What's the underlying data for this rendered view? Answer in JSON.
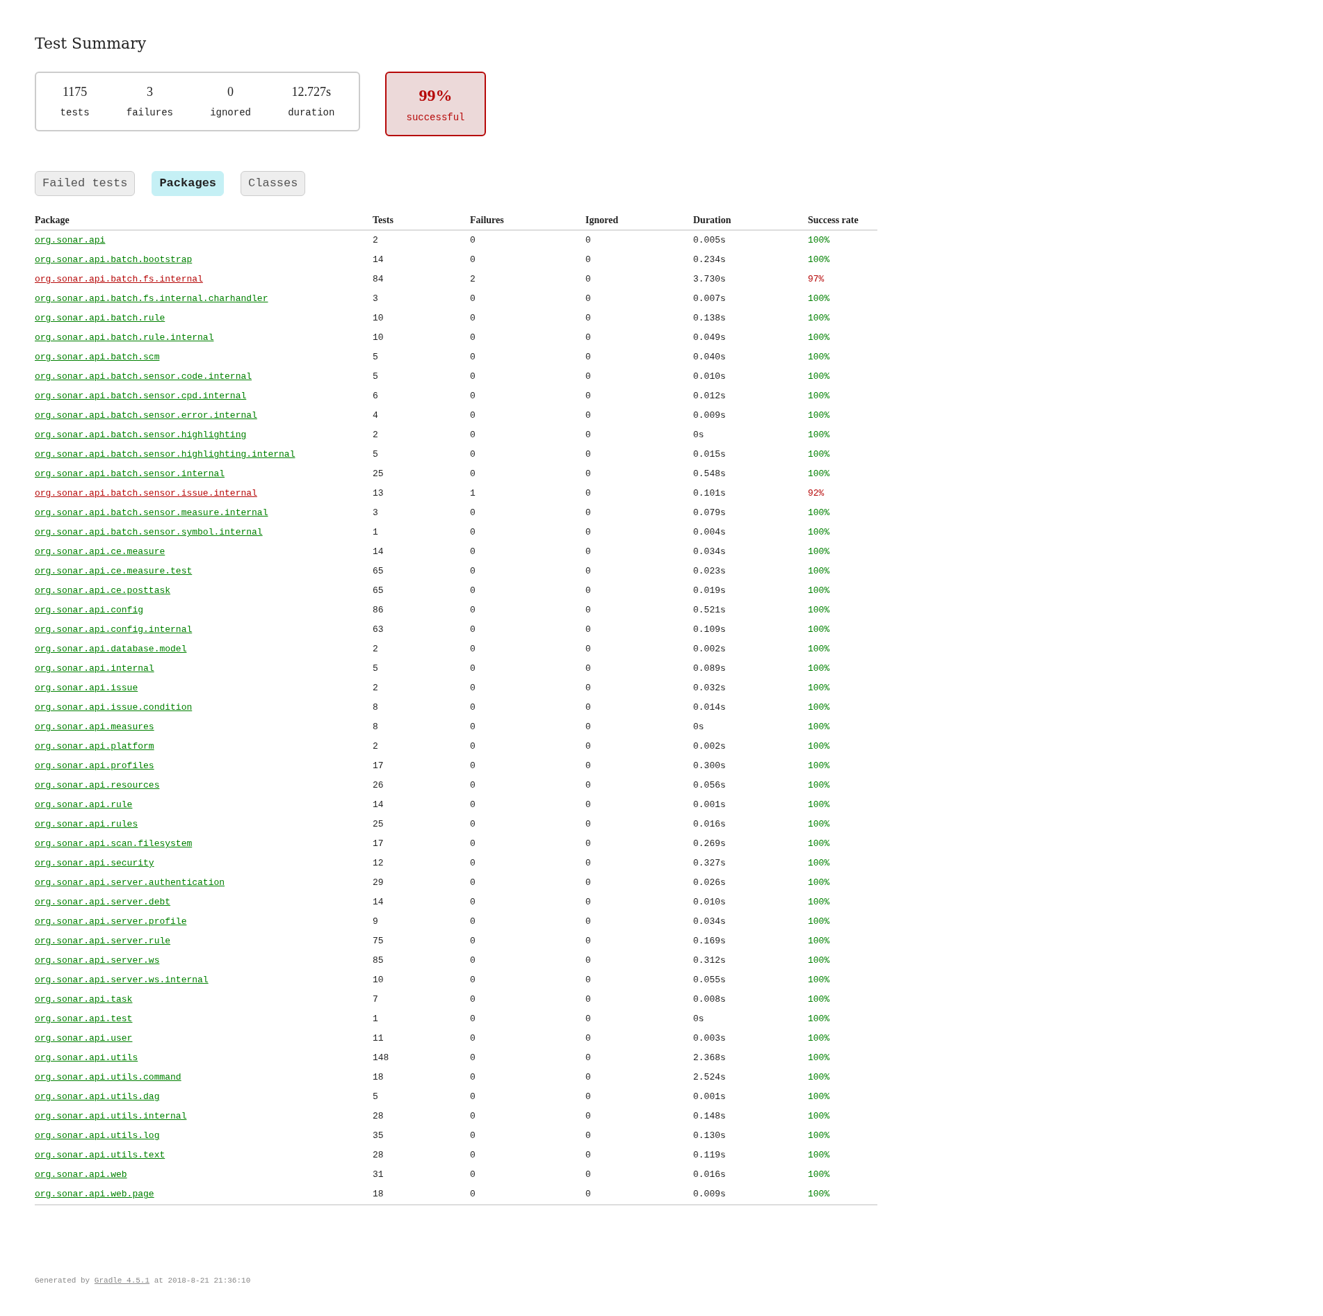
{
  "title": "Test Summary",
  "counters": [
    {
      "value": "1175",
      "label": "tests"
    },
    {
      "value": "3",
      "label": "failures"
    },
    {
      "value": "0",
      "label": "ignored"
    },
    {
      "value": "12.727s",
      "label": "duration"
    }
  ],
  "success": {
    "value": "99%",
    "label": "successful",
    "failed": true
  },
  "tabs": [
    {
      "label": "Failed tests",
      "selected": false
    },
    {
      "label": "Packages",
      "selected": true
    },
    {
      "label": "Classes",
      "selected": false
    }
  ],
  "table": {
    "columns": [
      "Package",
      "Tests",
      "Failures",
      "Ignored",
      "Duration",
      "Success rate"
    ],
    "rows": [
      {
        "package": "org.sonar.api",
        "tests": "2",
        "failures": "0",
        "ignored": "0",
        "duration": "0.005s",
        "success_rate": "100%",
        "failed": false
      },
      {
        "package": "org.sonar.api.batch.bootstrap",
        "tests": "14",
        "failures": "0",
        "ignored": "0",
        "duration": "0.234s",
        "success_rate": "100%",
        "failed": false
      },
      {
        "package": "org.sonar.api.batch.fs.internal",
        "tests": "84",
        "failures": "2",
        "ignored": "0",
        "duration": "3.730s",
        "success_rate": "97%",
        "failed": true
      },
      {
        "package": "org.sonar.api.batch.fs.internal.charhandler",
        "tests": "3",
        "failures": "0",
        "ignored": "0",
        "duration": "0.007s",
        "success_rate": "100%",
        "failed": false
      },
      {
        "package": "org.sonar.api.batch.rule",
        "tests": "10",
        "failures": "0",
        "ignored": "0",
        "duration": "0.138s",
        "success_rate": "100%",
        "failed": false
      },
      {
        "package": "org.sonar.api.batch.rule.internal",
        "tests": "10",
        "failures": "0",
        "ignored": "0",
        "duration": "0.049s",
        "success_rate": "100%",
        "failed": false
      },
      {
        "package": "org.sonar.api.batch.scm",
        "tests": "5",
        "failures": "0",
        "ignored": "0",
        "duration": "0.040s",
        "success_rate": "100%",
        "failed": false
      },
      {
        "package": "org.sonar.api.batch.sensor.code.internal",
        "tests": "5",
        "failures": "0",
        "ignored": "0",
        "duration": "0.010s",
        "success_rate": "100%",
        "failed": false
      },
      {
        "package": "org.sonar.api.batch.sensor.cpd.internal",
        "tests": "6",
        "failures": "0",
        "ignored": "0",
        "duration": "0.012s",
        "success_rate": "100%",
        "failed": false
      },
      {
        "package": "org.sonar.api.batch.sensor.error.internal",
        "tests": "4",
        "failures": "0",
        "ignored": "0",
        "duration": "0.009s",
        "success_rate": "100%",
        "failed": false
      },
      {
        "package": "org.sonar.api.batch.sensor.highlighting",
        "tests": "2",
        "failures": "0",
        "ignored": "0",
        "duration": "0s",
        "success_rate": "100%",
        "failed": false
      },
      {
        "package": "org.sonar.api.batch.sensor.highlighting.internal",
        "tests": "5",
        "failures": "0",
        "ignored": "0",
        "duration": "0.015s",
        "success_rate": "100%",
        "failed": false
      },
      {
        "package": "org.sonar.api.batch.sensor.internal",
        "tests": "25",
        "failures": "0",
        "ignored": "0",
        "duration": "0.548s",
        "success_rate": "100%",
        "failed": false
      },
      {
        "package": "org.sonar.api.batch.sensor.issue.internal",
        "tests": "13",
        "failures": "1",
        "ignored": "0",
        "duration": "0.101s",
        "success_rate": "92%",
        "failed": true
      },
      {
        "package": "org.sonar.api.batch.sensor.measure.internal",
        "tests": "3",
        "failures": "0",
        "ignored": "0",
        "duration": "0.079s",
        "success_rate": "100%",
        "failed": false
      },
      {
        "package": "org.sonar.api.batch.sensor.symbol.internal",
        "tests": "1",
        "failures": "0",
        "ignored": "0",
        "duration": "0.004s",
        "success_rate": "100%",
        "failed": false
      },
      {
        "package": "org.sonar.api.ce.measure",
        "tests": "14",
        "failures": "0",
        "ignored": "0",
        "duration": "0.034s",
        "success_rate": "100%",
        "failed": false
      },
      {
        "package": "org.sonar.api.ce.measure.test",
        "tests": "65",
        "failures": "0",
        "ignored": "0",
        "duration": "0.023s",
        "success_rate": "100%",
        "failed": false
      },
      {
        "package": "org.sonar.api.ce.posttask",
        "tests": "65",
        "failures": "0",
        "ignored": "0",
        "duration": "0.019s",
        "success_rate": "100%",
        "failed": false
      },
      {
        "package": "org.sonar.api.config",
        "tests": "86",
        "failures": "0",
        "ignored": "0",
        "duration": "0.521s",
        "success_rate": "100%",
        "failed": false
      },
      {
        "package": "org.sonar.api.config.internal",
        "tests": "63",
        "failures": "0",
        "ignored": "0",
        "duration": "0.109s",
        "success_rate": "100%",
        "failed": false
      },
      {
        "package": "org.sonar.api.database.model",
        "tests": "2",
        "failures": "0",
        "ignored": "0",
        "duration": "0.002s",
        "success_rate": "100%",
        "failed": false
      },
      {
        "package": "org.sonar.api.internal",
        "tests": "5",
        "failures": "0",
        "ignored": "0",
        "duration": "0.089s",
        "success_rate": "100%",
        "failed": false
      },
      {
        "package": "org.sonar.api.issue",
        "tests": "2",
        "failures": "0",
        "ignored": "0",
        "duration": "0.032s",
        "success_rate": "100%",
        "failed": false
      },
      {
        "package": "org.sonar.api.issue.condition",
        "tests": "8",
        "failures": "0",
        "ignored": "0",
        "duration": "0.014s",
        "success_rate": "100%",
        "failed": false
      },
      {
        "package": "org.sonar.api.measures",
        "tests": "8",
        "failures": "0",
        "ignored": "0",
        "duration": "0s",
        "success_rate": "100%",
        "failed": false
      },
      {
        "package": "org.sonar.api.platform",
        "tests": "2",
        "failures": "0",
        "ignored": "0",
        "duration": "0.002s",
        "success_rate": "100%",
        "failed": false
      },
      {
        "package": "org.sonar.api.profiles",
        "tests": "17",
        "failures": "0",
        "ignored": "0",
        "duration": "0.300s",
        "success_rate": "100%",
        "failed": false
      },
      {
        "package": "org.sonar.api.resources",
        "tests": "26",
        "failures": "0",
        "ignored": "0",
        "duration": "0.056s",
        "success_rate": "100%",
        "failed": false
      },
      {
        "package": "org.sonar.api.rule",
        "tests": "14",
        "failures": "0",
        "ignored": "0",
        "duration": "0.001s",
        "success_rate": "100%",
        "failed": false
      },
      {
        "package": "org.sonar.api.rules",
        "tests": "25",
        "failures": "0",
        "ignored": "0",
        "duration": "0.016s",
        "success_rate": "100%",
        "failed": false
      },
      {
        "package": "org.sonar.api.scan.filesystem",
        "tests": "17",
        "failures": "0",
        "ignored": "0",
        "duration": "0.269s",
        "success_rate": "100%",
        "failed": false
      },
      {
        "package": "org.sonar.api.security",
        "tests": "12",
        "failures": "0",
        "ignored": "0",
        "duration": "0.327s",
        "success_rate": "100%",
        "failed": false
      },
      {
        "package": "org.sonar.api.server.authentication",
        "tests": "29",
        "failures": "0",
        "ignored": "0",
        "duration": "0.026s",
        "success_rate": "100%",
        "failed": false
      },
      {
        "package": "org.sonar.api.server.debt",
        "tests": "14",
        "failures": "0",
        "ignored": "0",
        "duration": "0.010s",
        "success_rate": "100%",
        "failed": false
      },
      {
        "package": "org.sonar.api.server.profile",
        "tests": "9",
        "failures": "0",
        "ignored": "0",
        "duration": "0.034s",
        "success_rate": "100%",
        "failed": false
      },
      {
        "package": "org.sonar.api.server.rule",
        "tests": "75",
        "failures": "0",
        "ignored": "0",
        "duration": "0.169s",
        "success_rate": "100%",
        "failed": false
      },
      {
        "package": "org.sonar.api.server.ws",
        "tests": "85",
        "failures": "0",
        "ignored": "0",
        "duration": "0.312s",
        "success_rate": "100%",
        "failed": false
      },
      {
        "package": "org.sonar.api.server.ws.internal",
        "tests": "10",
        "failures": "0",
        "ignored": "0",
        "duration": "0.055s",
        "success_rate": "100%",
        "failed": false
      },
      {
        "package": "org.sonar.api.task",
        "tests": "7",
        "failures": "0",
        "ignored": "0",
        "duration": "0.008s",
        "success_rate": "100%",
        "failed": false
      },
      {
        "package": "org.sonar.api.test",
        "tests": "1",
        "failures": "0",
        "ignored": "0",
        "duration": "0s",
        "success_rate": "100%",
        "failed": false
      },
      {
        "package": "org.sonar.api.user",
        "tests": "11",
        "failures": "0",
        "ignored": "0",
        "duration": "0.003s",
        "success_rate": "100%",
        "failed": false
      },
      {
        "package": "org.sonar.api.utils",
        "tests": "148",
        "failures": "0",
        "ignored": "0",
        "duration": "2.368s",
        "success_rate": "100%",
        "failed": false
      },
      {
        "package": "org.sonar.api.utils.command",
        "tests": "18",
        "failures": "0",
        "ignored": "0",
        "duration": "2.524s",
        "success_rate": "100%",
        "failed": false
      },
      {
        "package": "org.sonar.api.utils.dag",
        "tests": "5",
        "failures": "0",
        "ignored": "0",
        "duration": "0.001s",
        "success_rate": "100%",
        "failed": false
      },
      {
        "package": "org.sonar.api.utils.internal",
        "tests": "28",
        "failures": "0",
        "ignored": "0",
        "duration": "0.148s",
        "success_rate": "100%",
        "failed": false
      },
      {
        "package": "org.sonar.api.utils.log",
        "tests": "35",
        "failures": "0",
        "ignored": "0",
        "duration": "0.130s",
        "success_rate": "100%",
        "failed": false
      },
      {
        "package": "org.sonar.api.utils.text",
        "tests": "28",
        "failures": "0",
        "ignored": "0",
        "duration": "0.119s",
        "success_rate": "100%",
        "failed": false
      },
      {
        "package": "org.sonar.api.web",
        "tests": "31",
        "failures": "0",
        "ignored": "0",
        "duration": "0.016s",
        "success_rate": "100%",
        "failed": false
      },
      {
        "package": "org.sonar.api.web.page",
        "tests": "18",
        "failures": "0",
        "ignored": "0",
        "duration": "0.009s",
        "success_rate": "100%",
        "failed": false
      }
    ]
  },
  "footer": {
    "prefix": "Generated by",
    "link": "Gradle 4.5.1",
    "suffix": "at 2018-8-21 21:36:10"
  }
}
